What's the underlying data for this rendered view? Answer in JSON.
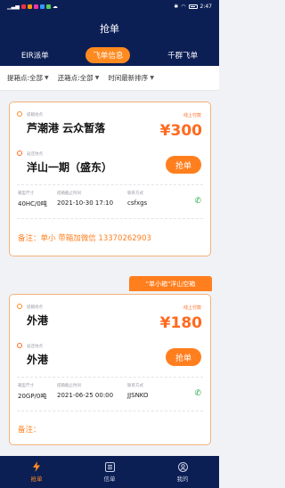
{
  "statusbar": {
    "time": "2:47"
  },
  "header": {
    "title": "抢单"
  },
  "tabs": [
    {
      "label": "EIR派单"
    },
    {
      "label": "飞单信息"
    },
    {
      "label": "千群飞单"
    }
  ],
  "filters": [
    {
      "label": "提箱点:全部"
    },
    {
      "label": "还箱点:全部"
    },
    {
      "label": "时间最新排序"
    }
  ],
  "labels": {
    "pickup": "提箱地点",
    "return": "返还地点",
    "online_pay": "线上付款",
    "box_type": "箱型尺寸",
    "deadline": "提箱截止时间",
    "contact": "联系方式"
  },
  "orders": [
    {
      "pickup": "芦潮港 云众暂落",
      "return": "洋山一期（盛东）",
      "price": "¥300",
      "grab_label": "抢单",
      "box": "40HC/0吨",
      "time": "2021-10-30 17:10",
      "contact": "csfxgs",
      "remark": "备注：单小 带箱加微信 13370262903"
    },
    {
      "ribbon": "\"单小箱\"洋山空箱",
      "pickup": "外港",
      "return": "外港",
      "price": "¥180",
      "grab_label": "抢单",
      "box": "20GP/0吨",
      "time": "2021-06-25 00:00",
      "contact": "JJSNKO",
      "remark": "备注："
    }
  ],
  "bottomnav": [
    {
      "label": "抢单",
      "icon": "lightning-icon"
    },
    {
      "label": "信单",
      "icon": "list-icon"
    },
    {
      "label": "我的",
      "icon": "user-icon"
    }
  ],
  "colors": {
    "brand_navy": "#0c1f55",
    "accent_orange": "#ff7f1f",
    "phone_green": "#2aa84a"
  }
}
